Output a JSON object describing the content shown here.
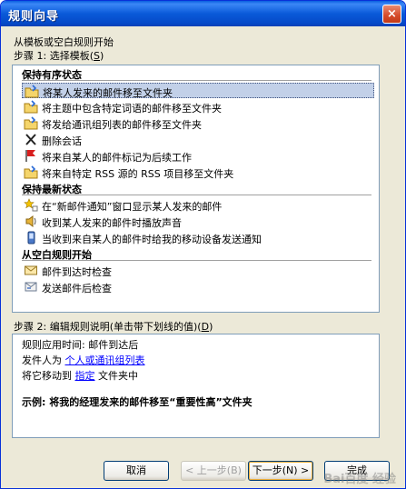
{
  "window": {
    "title": "规则向导",
    "close": "×"
  },
  "step1": {
    "intro": "从模板或空白规则开始",
    "label_prefix": "步骤 1: 选择模板(",
    "label_key": "S",
    "label_suffix": ")"
  },
  "templates": {
    "groups": [
      {
        "header": "保持有序状态",
        "items": [
          {
            "label": "将某人发来的邮件移至文件夹",
            "icon": "folder-move-icon",
            "selected": true
          },
          {
            "label": "将主题中包含特定词语的邮件移至文件夹",
            "icon": "folder-move-icon"
          },
          {
            "label": "将发给通讯组列表的邮件移至文件夹",
            "icon": "folder-move-icon"
          },
          {
            "label": "删除会话",
            "icon": "delete-x-icon"
          },
          {
            "label": "将来自某人的邮件标记为后续工作",
            "icon": "red-flag-icon"
          },
          {
            "label": "将来自特定 RSS 源的 RSS 项目移至文件夹",
            "icon": "folder-move-icon"
          }
        ]
      },
      {
        "header": "保持最新状态",
        "items": [
          {
            "label": "在“新邮件通知”窗口显示某人发来的邮件",
            "icon": "star-icon"
          },
          {
            "label": "收到某人发来的邮件时播放声音",
            "icon": "speaker-icon"
          },
          {
            "label": "当收到来自某人的邮件时给我的移动设备发送通知",
            "icon": "mobile-device-icon"
          }
        ]
      },
      {
        "header": "从空白规则开始",
        "items": [
          {
            "label": "邮件到达时检查",
            "icon": "envelope-icon"
          },
          {
            "label": "发送邮件后检查",
            "icon": "send-mail-icon"
          }
        ]
      }
    ]
  },
  "step2": {
    "label_prefix": "步骤 2: 编辑规则说明(单击带下划线的值)(",
    "label_key": "D",
    "label_suffix": ")",
    "line1": "规则应用时间: 邮件到达后",
    "line2_prefix": "发件人为 ",
    "line2_link": "个人或通讯组列表",
    "line3_prefix": "将它移动到 ",
    "line3_link": "指定",
    "line3_suffix": " 文件夹中",
    "example": "示例: 将我的经理发来的邮件移至“重要性高”文件夹"
  },
  "buttons": {
    "cancel": "取消",
    "back": "< 上一步(B)",
    "next": "下一步(N) >",
    "finish": "完成"
  },
  "watermark": "Bai百度 经验"
}
